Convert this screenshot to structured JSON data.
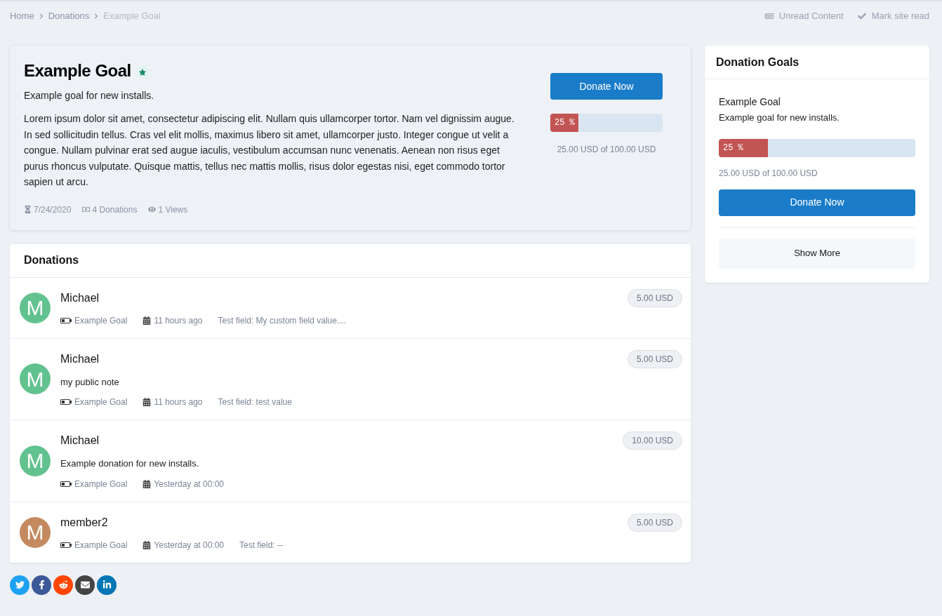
{
  "breadcrumbs": [
    {
      "label": "Home",
      "current": false
    },
    {
      "label": "Donations",
      "current": false
    },
    {
      "label": "Example Goal",
      "current": true
    }
  ],
  "top_links": [
    {
      "kind": "unread",
      "label": "Unread Content"
    },
    {
      "kind": "markread",
      "label": "Mark site read"
    }
  ],
  "goal": {
    "title": "Example Goal",
    "featured": true,
    "subtitle": "Example goal for new installs.",
    "body": "Lorem ipsum dolor sit amet, consectetur adipiscing elit. Nullam quis ullamcorper tortor. Nam vel dignissim augue. In sed sollicitudin tellus. Cras vel elit mollis, maximus libero sit amet, ullamcorper justo. Integer congue ut velit a congue. Nullam pulvinar erat sed augue iaculis, vestibulum accumsan nunc venenatis. Aenean non risus eget purus rhoncus vulputate. Quisque mattis, tellus nec mattis mollis, risus dolor egestas nisi, eget commodo tortor sapien ut arcu.",
    "meta": [
      {
        "kind": "date",
        "text": "7/24/2020"
      },
      {
        "kind": "donations",
        "text": "4 Donations"
      },
      {
        "kind": "views",
        "text": "1 Views"
      }
    ],
    "donate_button": "Donate Now",
    "progress": {
      "level": 0.25,
      "label": "25 %"
    },
    "amount": "25.00 USD of 100.00 USD"
  },
  "donations": {
    "title": "Donations",
    "items": [
      {
        "avatar": "M",
        "color": "#62c28f",
        "name": "Michael",
        "amount": "5.00 USD",
        "goal": "Example Goal",
        "time": "11 hours ago",
        "field": "Test field: My custom field value...."
      },
      {
        "avatar": "M",
        "color": "#62c28f",
        "name": "Michael",
        "amount": "5.00 USD",
        "note": "my public note",
        "goal": "Example Goal",
        "time": "11 hours ago",
        "field": "Test field: test value"
      },
      {
        "avatar": "M",
        "color": "#62c28f",
        "name": "Michael",
        "amount": "10.00 USD",
        "note": "Example donation for new installs.",
        "goal": "Example Goal",
        "time": "Yesterday at 00:00"
      },
      {
        "avatar": "M",
        "color": "#c48a5f",
        "name": "member2",
        "amount": "5.00 USD",
        "goal": "Example Goal",
        "time": "Yesterday at 00:00",
        "field": "Test field: --"
      }
    ]
  },
  "share": [
    {
      "kind": "twitter"
    },
    {
      "kind": "facebook"
    },
    {
      "kind": "reddit"
    },
    {
      "kind": "email"
    },
    {
      "kind": "linkedin"
    }
  ],
  "sidebar": {
    "title": "Donation Goals",
    "goal_title": "Example Goal",
    "goal_subtitle": "Example goal for new installs.",
    "progress": {
      "level": 0.25,
      "label": "25 %"
    },
    "amount": "25.00 USD of 100.00 USD",
    "donate_button": "Donate Now",
    "show_more": "Show More"
  }
}
